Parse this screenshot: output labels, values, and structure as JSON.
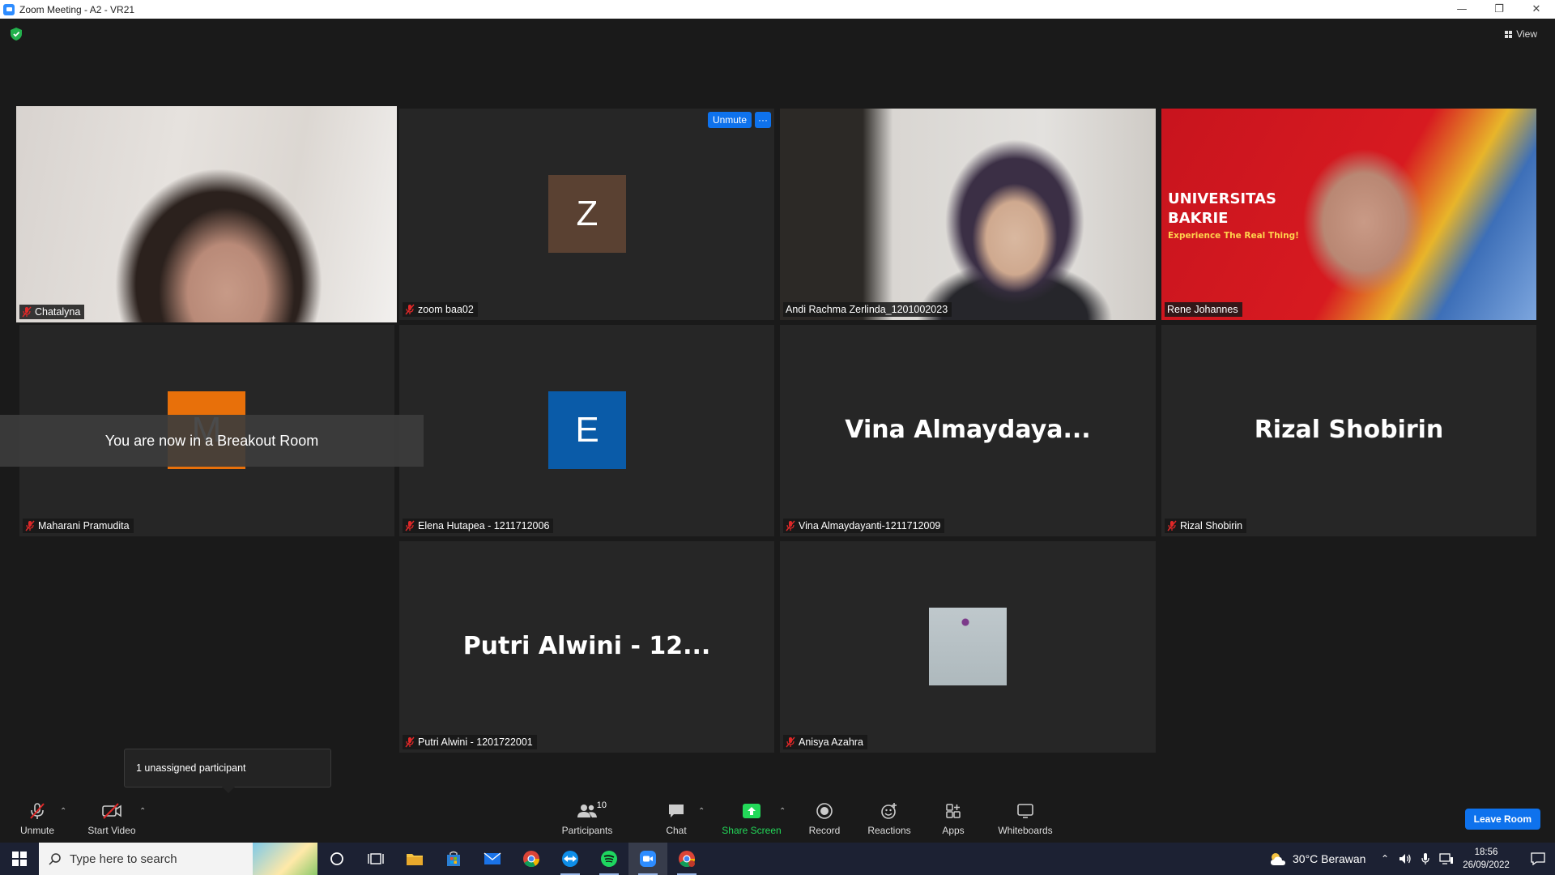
{
  "window": {
    "title": "Zoom Meeting - A2 - VR21"
  },
  "top": {
    "view_label": "View"
  },
  "tiles": [
    {
      "name": "Chatalyna",
      "muted": true,
      "video": true,
      "active": true
    },
    {
      "name": "zoom baa02",
      "muted": true,
      "avatar_letter": "Z",
      "avatar_color": "#5a4132",
      "unmute_label": "Unmute",
      "more_label": "···"
    },
    {
      "name": "Andi Rachma Zerlinda_1201002023",
      "muted": false,
      "video": true
    },
    {
      "name": "Rene Johannes",
      "muted": false,
      "video": true,
      "banner_line1": "UNIVERSITAS",
      "banner_line2": "BAKRIE",
      "banner_tagline": "Experience The Real Thing!"
    },
    {
      "name": "Maharani Pramudita",
      "muted": true,
      "avatar_letter": "M",
      "avatar_color": "#e8700a"
    },
    {
      "name": "Elena Hutapea - 1211712006",
      "muted": true,
      "avatar_letter": "E",
      "avatar_color": "#0a5ba8"
    },
    {
      "name": "Vina Almaydayanti-1211712009",
      "muted": true,
      "display_name": "Vina  Almaydaya..."
    },
    {
      "name": "Rizal Shobirin",
      "muted": true,
      "display_name": "Rizal Shobirin"
    },
    {
      "name": "Putri Alwini - 1201722001",
      "muted": true,
      "display_name": "Putri Alwini - 12..."
    },
    {
      "name": "Anisya Azahra",
      "muted": true,
      "avatar_image": true
    }
  ],
  "toast": {
    "text": "You are now in a Breakout Room"
  },
  "tooltip": {
    "text": "1 unassigned participant"
  },
  "toolbar": {
    "unmute_label": "Unmute",
    "start_video_label": "Start Video",
    "participants_label": "Participants",
    "participants_count": "10",
    "chat_label": "Chat",
    "share_label": "Share Screen",
    "record_label": "Record",
    "reactions_label": "Reactions",
    "apps_label": "Apps",
    "whiteboards_label": "Whiteboards",
    "leave_label": "Leave Room",
    "share_color": "#23d959"
  },
  "taskbar": {
    "search_placeholder": "Type here to search",
    "weather": "30°C  Berawan",
    "time": "18:56",
    "date": "26/09/2022"
  }
}
